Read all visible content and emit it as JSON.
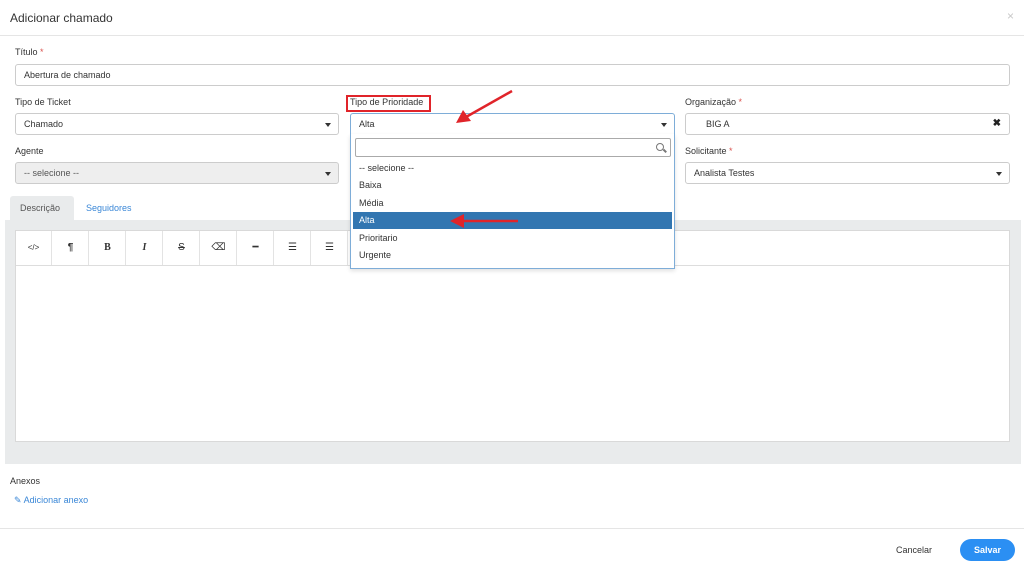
{
  "modal": {
    "title": "Adicionar chamado",
    "close": "×"
  },
  "fields": {
    "titulo": {
      "label": "Título",
      "required": "*",
      "value": "Abertura de chamado"
    },
    "tipo_ticket": {
      "label": "Tipo de Ticket",
      "value": "Chamado"
    },
    "tipo_prioridade": {
      "label": "Tipo de Prioridade",
      "value": "Alta"
    },
    "organizacao": {
      "label": "Organização",
      "required": "*",
      "value": "BIG A",
      "clear": "✖"
    },
    "agente": {
      "label": "Agente",
      "value": "-- selecione --"
    },
    "solicitante": {
      "label": "Solicitante",
      "required": "*",
      "value": "Analista Testes"
    }
  },
  "dropdown": {
    "options": [
      "-- selecione --",
      "Baixa",
      "Média",
      "Alta",
      "Prioritario",
      "Urgente"
    ],
    "selected": "Alta"
  },
  "tabs": [
    {
      "label": "Descrição",
      "active": true
    },
    {
      "label": "Seguidores",
      "active": false
    }
  ],
  "toolbar": {
    "code": "</>",
    "paragraph": "¶",
    "bold": "B",
    "italic": "I",
    "strike": "S",
    "eraser": "⌫",
    "hr": "━",
    "ordered_list": "☰",
    "unordered_list": "☰"
  },
  "attachments": {
    "label": "Anexos",
    "link": "Adicionar anexo",
    "icon": "paperclip-icon"
  },
  "footer": {
    "cancel": "Cancelar",
    "save": "Salvar"
  },
  "colors": {
    "accent": "#2b8ff3",
    "selected": "#3276b1",
    "annotation": "#e0242a",
    "link": "#3a87d7"
  }
}
